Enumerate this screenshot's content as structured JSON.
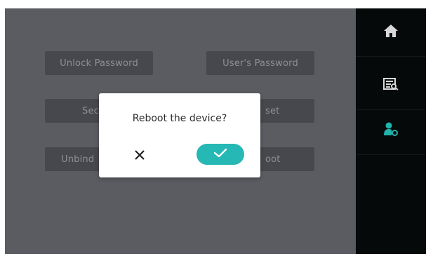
{
  "menu": {
    "items": [
      {
        "label": "Unlock Password"
      },
      {
        "label": "User's Password"
      },
      {
        "label": "Sec"
      },
      {
        "label": "set"
      },
      {
        "label": "Unbind"
      },
      {
        "label": "oot"
      }
    ]
  },
  "sidebar": {
    "items": [
      {
        "icon": "home-icon",
        "color": "#d8d8d8",
        "active": false
      },
      {
        "icon": "records-icon",
        "color": "#d8d8d8",
        "active": false
      },
      {
        "icon": "user-settings-icon",
        "color": "#22b3ad",
        "active": true
      }
    ]
  },
  "dialog": {
    "message": "Reboot the device?",
    "cancel_icon": "close-icon",
    "confirm_icon": "check-icon",
    "confirm_color": "#26b8b4"
  }
}
